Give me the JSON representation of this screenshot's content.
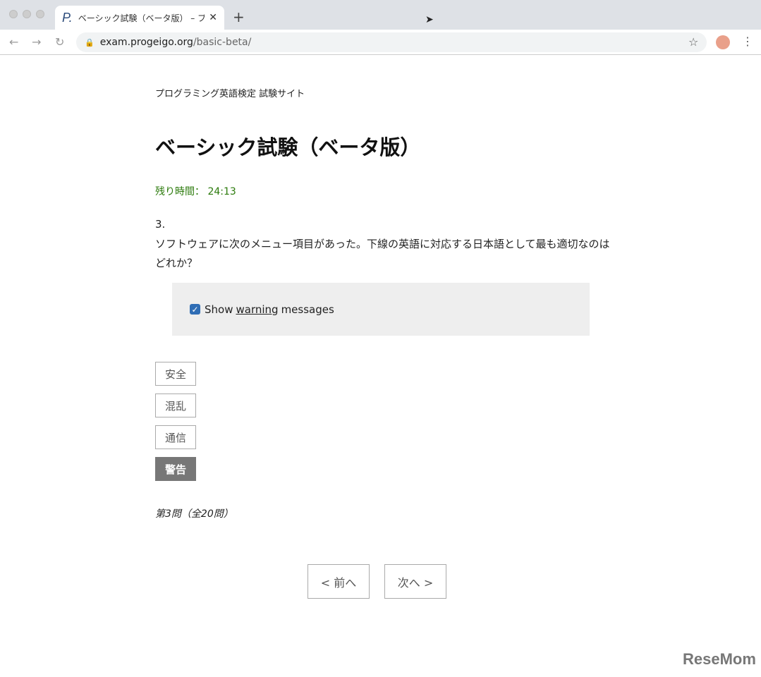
{
  "browser": {
    "tab_title": "ベーシック試験（ベータ版） – プログ",
    "url_host": "exam.progeigo.org",
    "url_path": "/basic-beta/",
    "favicon": "P.",
    "new_tab": "+",
    "close": "✕"
  },
  "page": {
    "site_name": "プログラミング英語検定 試験サイト",
    "title": "ベーシック試験（ベータ版）",
    "timer_label": "残り時間：",
    "timer_value": "24:13",
    "question_number": "3.",
    "question_text": "ソフトウェアに次のメニュー項目があった。下線の英語に対応する日本語として最も適切なのはどれか？",
    "example": {
      "before": "Show",
      "underlined": "warning",
      "after": "messages",
      "checked": true
    },
    "choices": [
      {
        "label": "安全",
        "selected": false
      },
      {
        "label": "混乱",
        "selected": false
      },
      {
        "label": "通信",
        "selected": false
      },
      {
        "label": "警告",
        "selected": true
      }
    ],
    "progress": "第3問（全20問）",
    "prev": "< 前へ",
    "next": "次へ >"
  },
  "watermark": "ReseMom"
}
